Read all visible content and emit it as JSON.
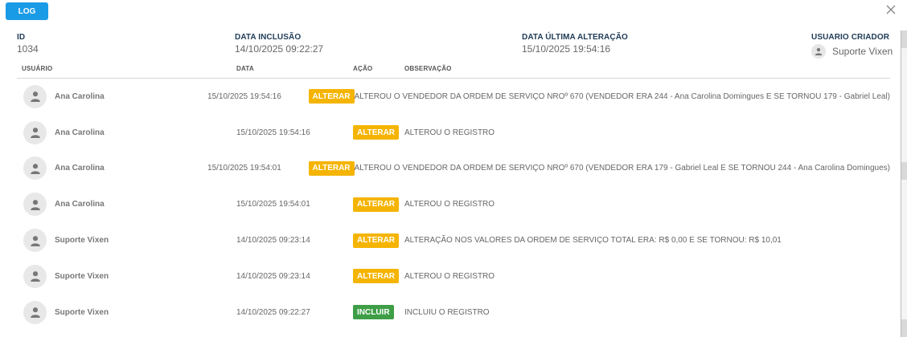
{
  "dialog": {
    "badge": "LOG"
  },
  "meta": {
    "id_label": "ID",
    "id_value": "1034",
    "inclusion_label": "DATA INCLUSÃO",
    "inclusion_value": "14/10/2025 09:22:27",
    "last_change_label": "DATA ÚLTIMA ALTERAÇÃO",
    "last_change_value": "15/10/2025 19:54:16",
    "creator_label": "USUARIO CRIADOR",
    "creator_value": "Suporte Vixen"
  },
  "table": {
    "headers": {
      "user": "USUÁRIO",
      "date": "DATA",
      "action": "AÇÃO",
      "note": "OBSERVAÇÃO"
    },
    "rows": [
      {
        "user": "Ana Carolina",
        "date": "15/10/2025 19:54:16",
        "action": "ALTERAR",
        "note": "ALTEROU O VENDEDOR DA ORDEM DE SERVIÇO NROº 670 (VENDEDOR ERA 244 - Ana Carolina Domingues E SE TORNOU 179 - Gabriel Leal)"
      },
      {
        "user": "Ana Carolina",
        "date": "15/10/2025 19:54:16",
        "action": "ALTERAR",
        "note": "ALTEROU O REGISTRO"
      },
      {
        "user": "Ana Carolina",
        "date": "15/10/2025 19:54:01",
        "action": "ALTERAR",
        "note": "ALTEROU O VENDEDOR DA ORDEM DE SERVIÇO NROº 670 (VENDEDOR ERA 179 - Gabriel Leal E SE TORNOU 244 - Ana Carolina Domingues)"
      },
      {
        "user": "Ana Carolina",
        "date": "15/10/2025 19:54:01",
        "action": "ALTERAR",
        "note": "ALTEROU O REGISTRO"
      },
      {
        "user": "Suporte Vixen",
        "date": "14/10/2025 09:23:14",
        "action": "ALTERAR",
        "note": "ALTERAÇÃO NOS VALORES DA ORDEM DE SERVIÇO TOTAL ERA: R$ 0,00 E SE TORNOU: R$ 10,01"
      },
      {
        "user": "Suporte Vixen",
        "date": "14/10/2025 09:23:14",
        "action": "ALTERAR",
        "note": "ALTEROU O REGISTRO"
      },
      {
        "user": "Suporte Vixen",
        "date": "14/10/2025 09:22:27",
        "action": "INCLUIR",
        "note": "INCLUIU O REGISTRO"
      }
    ]
  },
  "colors": {
    "accent": "#1a9be6",
    "alter": "#f5b400",
    "include": "#3e9e47"
  },
  "icons": {
    "close": "close-icon",
    "avatar": "person-icon"
  }
}
